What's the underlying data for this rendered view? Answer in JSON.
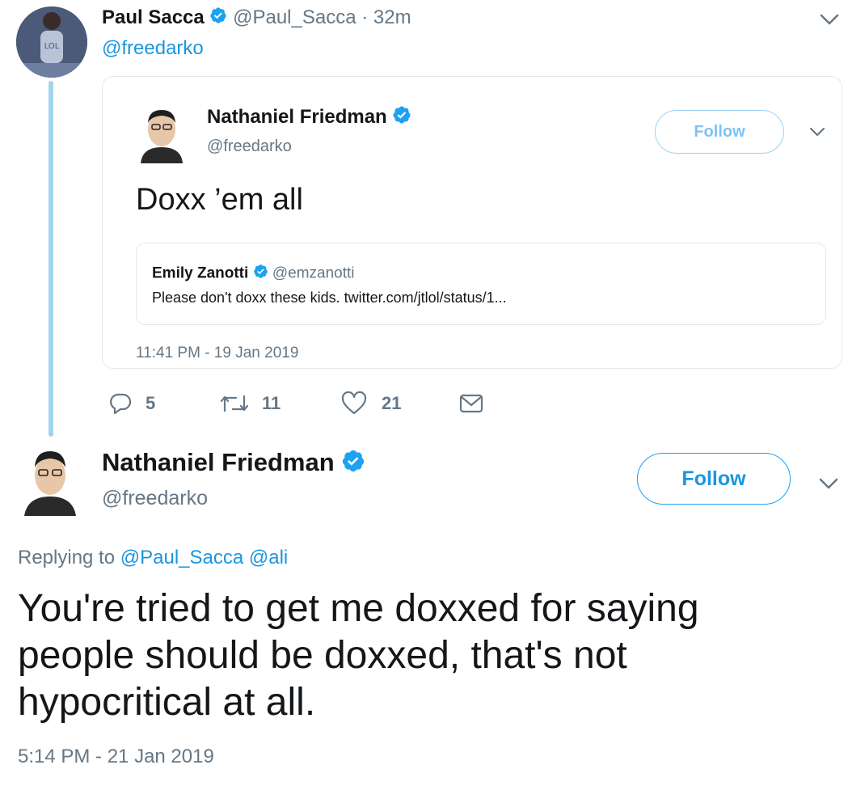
{
  "parent_tweet": {
    "author_name": "Paul Sacca",
    "author_handle": "@Paul_Sacca",
    "time_separator": "·",
    "time": "32m",
    "reply_text": "@freedarko",
    "quoted_tweet": {
      "author_name": "Nathaniel Friedman",
      "author_handle": "@freedarko",
      "follow_label": "Follow",
      "text": "Doxx ’em all",
      "nested_quote": {
        "author_name": "Emily Zanotti",
        "author_handle": "@emzanotti",
        "text": "Please don't doxx these kids. twitter.com/jtlol/status/1..."
      },
      "timestamp": "11:41 PM - 19 Jan 2019"
    },
    "actions": {
      "replies": "5",
      "retweets": "11",
      "likes": "21"
    }
  },
  "main_tweet": {
    "author_name": "Nathaniel Friedman",
    "author_handle": "@freedarko",
    "follow_label": "Follow",
    "replying_prefix": "Replying to",
    "replying_to": [
      "@Paul_Sacca",
      "@ali"
    ],
    "text": "You're tried to get me doxxed for saying people should be doxxed, that's not hypocritical at all.",
    "timestamp": "5:14 PM - 21 Jan 2019"
  },
  "colors": {
    "link_blue": "#1b95e0",
    "verified_blue": "#1da1f2",
    "muted_grey": "#657786",
    "thread_line": "#a3d3ef"
  }
}
